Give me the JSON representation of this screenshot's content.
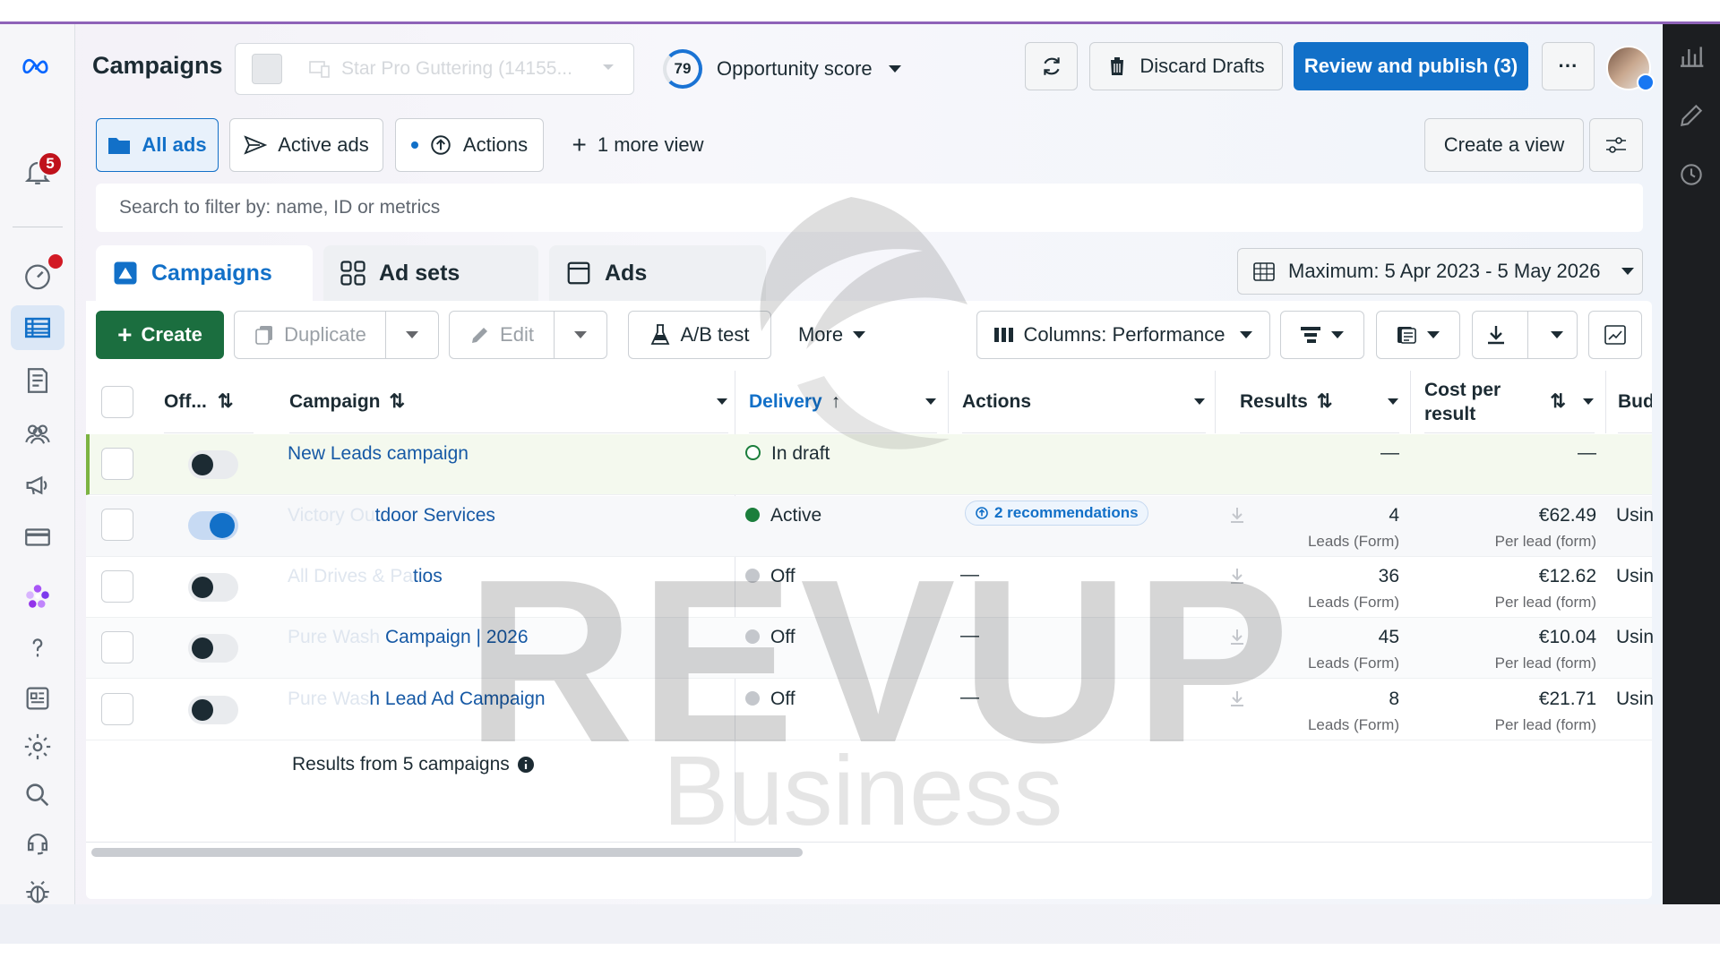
{
  "header": {
    "title": "Campaigns",
    "account_name": "Star Pro Guttering (14155...",
    "opportunity_score": "79",
    "opportunity_label": "Opportunity score",
    "discard_label": "Discard Drafts",
    "publish_label": "Review and publish (3)",
    "more_label": "···"
  },
  "notifications": {
    "count": "5"
  },
  "views": {
    "all_ads": "All ads",
    "active_ads": "Active ads",
    "actions": "Actions",
    "more_view": "1 more view",
    "create_view": "Create a view"
  },
  "search": {
    "placeholder": "Search to filter by: name, ID or metrics"
  },
  "level_tabs": {
    "campaigns": "Campaigns",
    "ad_sets": "Ad sets",
    "ads": "Ads"
  },
  "date_range": "Maximum: 5 Apr 2023 - 5 May 2026",
  "toolbar": {
    "create": "Create",
    "duplicate": "Duplicate",
    "edit": "Edit",
    "ab_test": "A/B test",
    "more": "More",
    "columns": "Columns: Performance"
  },
  "table": {
    "headers": {
      "off": "Off...",
      "campaign": "Campaign",
      "delivery": "Delivery",
      "actions": "Actions",
      "results": "Results",
      "cost_line1": "Cost per",
      "cost_line2": "result",
      "budget": "Bud"
    },
    "rows": [
      {
        "name_faded": "",
        "name": "New Leads campaign",
        "delivery": "In draft",
        "actions": "",
        "results": "—",
        "results_sub": "",
        "cost": "—",
        "cost_sub": "",
        "budget": ""
      },
      {
        "name_faded": "Victory Ou",
        "name": "tdoor Services",
        "delivery": "Active",
        "actions": "2 recommendations",
        "results": "4",
        "results_sub": "Leads (Form)",
        "cost": "€62.49",
        "cost_sub": "Per lead (form)",
        "budget": "Usin"
      },
      {
        "name_faded": "All Drives & Pa",
        "name": "tios",
        "delivery": "Off",
        "actions": "—",
        "results": "36",
        "results_sub": "Leads (Form)",
        "cost": "€12.62",
        "cost_sub": "Per lead (form)",
        "budget": "Usin"
      },
      {
        "name_faded": "Pure Wash ",
        "name": "Campaign | 2026",
        "delivery": "Off",
        "actions": "—",
        "results": "45",
        "results_sub": "Leads (Form)",
        "cost": "€10.04",
        "cost_sub": "Per lead (form)",
        "budget": "Usin"
      },
      {
        "name_faded": "Pure Was",
        "name": "h Lead Ad Campaign",
        "delivery": "Off",
        "actions": "—",
        "results": "8",
        "results_sub": "Leads (Form)",
        "cost": "€21.71",
        "cost_sub": "Per lead (form)",
        "budget": "Usin"
      }
    ],
    "footer": "Results from 5 campaigns"
  },
  "watermark": {
    "brand": "REVUP",
    "sub": "Business"
  },
  "colors": {
    "accent": "#1270c8",
    "create_green": "#1b6e3f",
    "active_green": "#1b7e3c",
    "draft_bg": "#f4f9ee"
  }
}
